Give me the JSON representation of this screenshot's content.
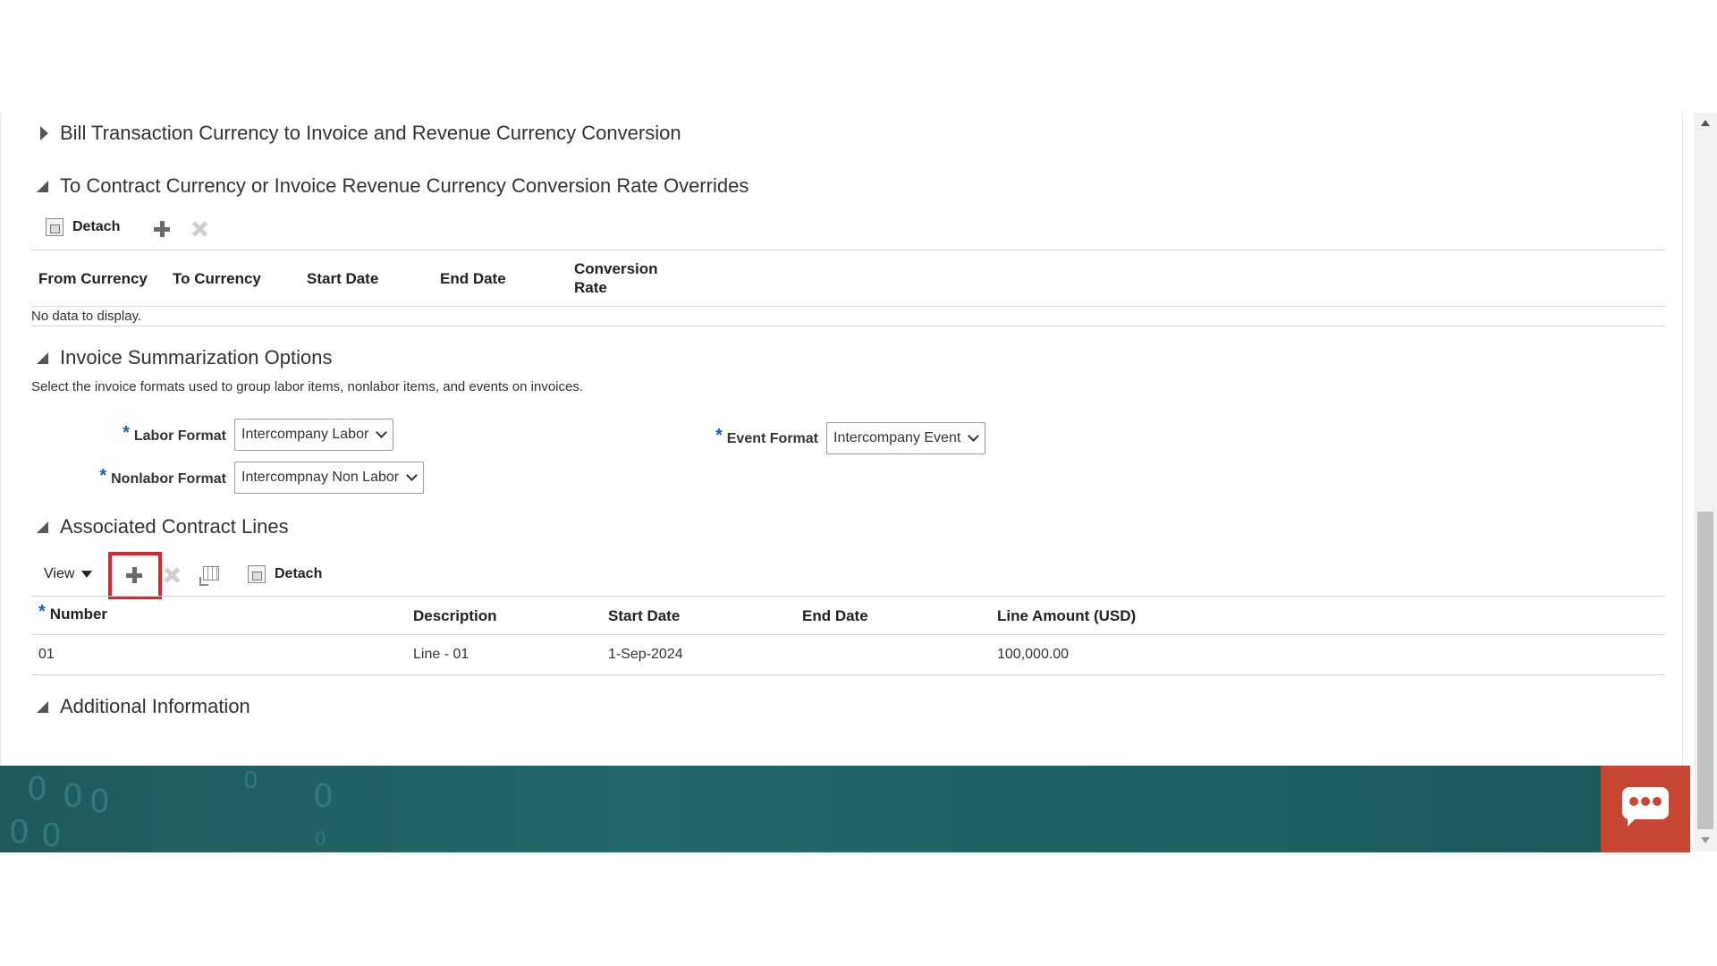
{
  "sections": {
    "bill_conversion": {
      "title": "Bill Transaction Currency to Invoice and Revenue Currency Conversion"
    },
    "rate_overrides": {
      "title": "To Contract Currency or Invoice Revenue Currency Conversion Rate Overrides",
      "detach_label": "Detach",
      "columns": [
        "From Currency",
        "To Currency",
        "Start Date",
        "End Date",
        "Conversion",
        "Rate"
      ],
      "empty_text": "No data to display."
    },
    "invoice_summarization": {
      "title": "Invoice Summarization Options",
      "description": "Select the invoice formats used to group labor items, nonlabor items, and events on invoices.",
      "required_marker": "*",
      "labor_format_label": "Labor Format",
      "labor_format_value": "Intercompany Labor",
      "nonlabor_format_label": "Nonlabor Format",
      "nonlabor_format_value": "Intercompnay Non Labor",
      "event_format_label": "Event Format",
      "event_format_value": "Intercompany Event"
    },
    "associated_lines": {
      "title": "Associated Contract Lines",
      "view_label": "View",
      "detach_label": "Detach",
      "columns": {
        "required_marker": "*",
        "number": "Number",
        "description": "Description",
        "start_date": "Start Date",
        "end_date": "End Date",
        "line_amount": "Line Amount (USD)"
      },
      "rows": [
        {
          "number": "01",
          "description": "Line - 01",
          "start_date": "1-Sep-2024",
          "end_date": "",
          "line_amount": "100,000.00"
        }
      ]
    },
    "additional_info": {
      "title": "Additional Information"
    }
  },
  "colors": {
    "highlight": "#e8202a",
    "footer": "#23686b",
    "chat_button": "#c74634",
    "required_marker": "#1a5fb4"
  },
  "icons": [
    "expand-triangle-icon",
    "collapse-triangle-icon",
    "detach-icon",
    "add-icon",
    "delete-icon",
    "freeze-icon",
    "chat-icon"
  ]
}
